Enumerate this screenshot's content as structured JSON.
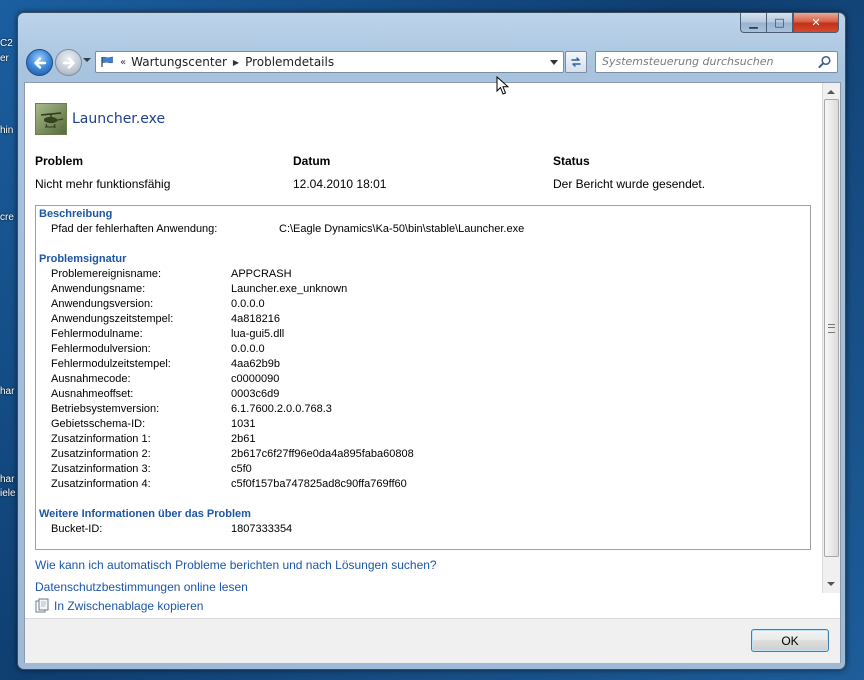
{
  "desktop": {
    "fragments": [
      "C2",
      "er",
      "hin",
      "cre",
      "har",
      "har",
      "iele"
    ]
  },
  "window": {
    "controls": {
      "minimize": "▁",
      "maximize": "□",
      "close": "✕"
    }
  },
  "navbar": {
    "breadcrumb": [
      "Wartungscenter",
      "Problemdetails"
    ],
    "search_placeholder": "Systemsteuerung durchsuchen"
  },
  "app": {
    "title": "Launcher.exe"
  },
  "summary": {
    "headers": [
      "Problem",
      "Datum",
      "Status"
    ],
    "values": [
      "Nicht mehr funktionsfähig",
      "12.04.2010 18:01",
      "Der Bericht wurde gesendet."
    ]
  },
  "details": {
    "beschreibung": {
      "title": "Beschreibung",
      "key": "Pfad der fehlerhaften Anwendung:",
      "value": "C:\\Eagle Dynamics\\Ka-50\\bin\\stable\\Launcher.exe"
    },
    "signatur": {
      "title": "Problemsignatur",
      "rows": [
        {
          "k": "Problemereignisname:",
          "v": "APPCRASH"
        },
        {
          "k": "Anwendungsname:",
          "v": "Launcher.exe_unknown"
        },
        {
          "k": "Anwendungsversion:",
          "v": "0.0.0.0"
        },
        {
          "k": "Anwendungszeitstempel:",
          "v": "4a818216"
        },
        {
          "k": "Fehlermodulname:",
          "v": "lua-gui5.dll"
        },
        {
          "k": "Fehlermodulversion:",
          "v": "0.0.0.0"
        },
        {
          "k": "Fehlermodulzeitstempel:",
          "v": "4aa62b9b"
        },
        {
          "k": "Ausnahmecode:",
          "v": "c0000090"
        },
        {
          "k": "Ausnahmeoffset:",
          "v": "0003c6d9"
        },
        {
          "k": "Betriebsystemversion:",
          "v": "6.1.7600.2.0.0.768.3"
        },
        {
          "k": "Gebietsschema-ID:",
          "v": "1031"
        },
        {
          "k": "Zusatzinformation 1:",
          "v": "2b61"
        },
        {
          "k": "Zusatzinformation 2:",
          "v": "2b617c6f27ff96e0da4a895faba60808"
        },
        {
          "k": "Zusatzinformation 3:",
          "v": "c5f0"
        },
        {
          "k": "Zusatzinformation 4:",
          "v": "c5f0f157ba747825ad8c90ffa769ff60"
        }
      ]
    },
    "weitere": {
      "title": "Weitere Informationen über das Problem",
      "rows": [
        {
          "k": "Bucket-ID:",
          "v": "1807333354"
        }
      ]
    }
  },
  "links": {
    "auto_report": "Wie kann ich automatisch Probleme berichten und nach Lösungen suchen?",
    "privacy": "Datenschutzbestimmungen online lesen",
    "copy": "In Zwischenablage kopieren"
  },
  "buttons": {
    "ok": "OK"
  }
}
